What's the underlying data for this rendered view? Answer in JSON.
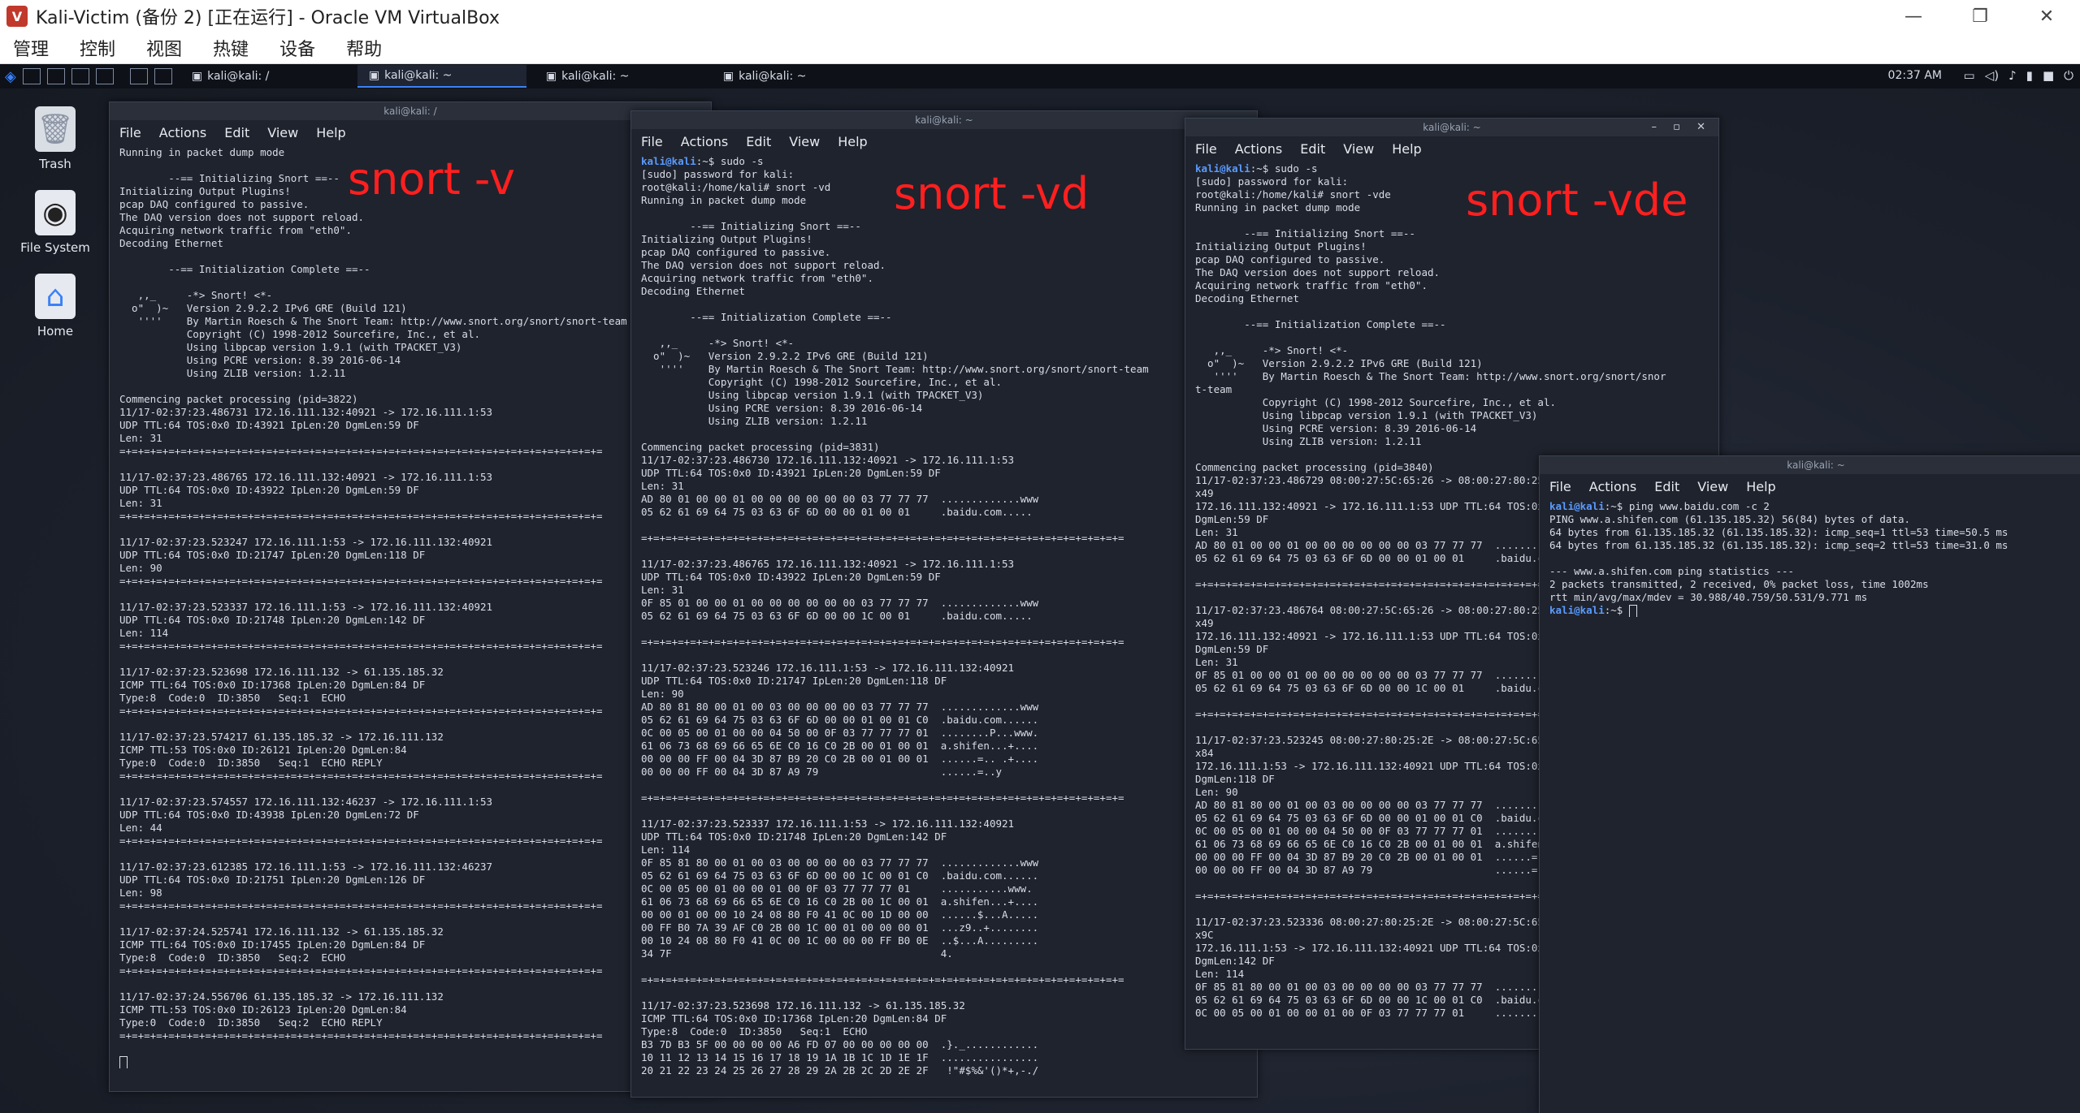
{
  "vbox": {
    "title": "Kali-Victim (备份 2) [正在运行] - Oracle VM VirtualBox",
    "menu": [
      "管理",
      "控制",
      "视图",
      "热键",
      "设备",
      "帮助"
    ],
    "min_label": "—",
    "max_label": "❐",
    "close_label": "✕"
  },
  "panel": {
    "tasks": [
      "kali@kali: /",
      "kali@kali: ~",
      "kali@kali: ~",
      "kali@kali: ~"
    ],
    "clock": "02:37 AM"
  },
  "desktop_icons": [
    {
      "label": "Trash",
      "icon": "trash-icon"
    },
    {
      "label": "File System",
      "icon": "drive-icon"
    },
    {
      "label": "Home",
      "icon": "home-icon"
    }
  ],
  "colors": {
    "annotation": "#ff1f1f",
    "prompt": "#5a9bff",
    "terminal_bg": "#1f232d"
  },
  "term_menu": [
    "File",
    "Actions",
    "Edit",
    "View",
    "Help"
  ],
  "terminals": [
    {
      "title": "kali@kali: /",
      "annotation": "snort -v",
      "lines": [
        "Running in packet dump mode",
        "",
        "        --== Initializing Snort ==--",
        "Initializing Output Plugins!",
        "pcap DAQ configured to passive.",
        "The DAQ version does not support reload.",
        "Acquiring network traffic from \"eth0\".",
        "Decoding Ethernet",
        "",
        "        --== Initialization Complete ==--",
        "",
        "   ,,_     -*> Snort! <*-",
        "  o\"  )~   Version 2.9.2.2 IPv6 GRE (Build 121)",
        "   ''''    By Martin Roesch & The Snort Team: http://www.snort.org/snort/snort-team",
        "           Copyright (C) 1998-2012 Sourcefire, Inc., et al.",
        "           Using libpcap version 1.9.1 (with TPACKET_V3)",
        "           Using PCRE version: 8.39 2016-06-14",
        "           Using ZLIB version: 1.2.11",
        "",
        "Commencing packet processing (pid=3822)",
        "11/17-02:37:23.486731 172.16.111.132:40921 -> 172.16.111.1:53",
        "UDP TTL:64 TOS:0x0 ID:43921 IpLen:20 DgmLen:59 DF",
        "Len: 31",
        "=+=+=+=+=+=+=+=+=+=+=+=+=+=+=+=+=+=+=+=+=+=+=+=+=+=+=+=+=+=+=+=+=+=+=+=+=+=+=+=",
        "",
        "11/17-02:37:23.486765 172.16.111.132:40921 -> 172.16.111.1:53",
        "UDP TTL:64 TOS:0x0 ID:43922 IpLen:20 DgmLen:59 DF",
        "Len: 31",
        "=+=+=+=+=+=+=+=+=+=+=+=+=+=+=+=+=+=+=+=+=+=+=+=+=+=+=+=+=+=+=+=+=+=+=+=+=+=+=+=",
        "",
        "11/17-02:37:23.523247 172.16.111.1:53 -> 172.16.111.132:40921",
        "UDP TTL:64 TOS:0x0 ID:21747 IpLen:20 DgmLen:118 DF",
        "Len: 90",
        "=+=+=+=+=+=+=+=+=+=+=+=+=+=+=+=+=+=+=+=+=+=+=+=+=+=+=+=+=+=+=+=+=+=+=+=+=+=+=+=",
        "",
        "11/17-02:37:23.523337 172.16.111.1:53 -> 172.16.111.132:40921",
        "UDP TTL:64 TOS:0x0 ID:21748 IpLen:20 DgmLen:142 DF",
        "Len: 114",
        "=+=+=+=+=+=+=+=+=+=+=+=+=+=+=+=+=+=+=+=+=+=+=+=+=+=+=+=+=+=+=+=+=+=+=+=+=+=+=+=",
        "",
        "11/17-02:37:23.523698 172.16.111.132 -> 61.135.185.32",
        "ICMP TTL:64 TOS:0x0 ID:17368 IpLen:20 DgmLen:84 DF",
        "Type:8  Code:0  ID:3850   Seq:1  ECHO",
        "=+=+=+=+=+=+=+=+=+=+=+=+=+=+=+=+=+=+=+=+=+=+=+=+=+=+=+=+=+=+=+=+=+=+=+=+=+=+=+=",
        "",
        "11/17-02:37:23.574217 61.135.185.32 -> 172.16.111.132",
        "ICMP TTL:53 TOS:0x0 ID:26121 IpLen:20 DgmLen:84",
        "Type:0  Code:0  ID:3850   Seq:1  ECHO REPLY",
        "=+=+=+=+=+=+=+=+=+=+=+=+=+=+=+=+=+=+=+=+=+=+=+=+=+=+=+=+=+=+=+=+=+=+=+=+=+=+=+=",
        "",
        "11/17-02:37:23.574557 172.16.111.132:46237 -> 172.16.111.1:53",
        "UDP TTL:64 TOS:0x0 ID:43938 IpLen:20 DgmLen:72 DF",
        "Len: 44",
        "=+=+=+=+=+=+=+=+=+=+=+=+=+=+=+=+=+=+=+=+=+=+=+=+=+=+=+=+=+=+=+=+=+=+=+=+=+=+=+=",
        "",
        "11/17-02:37:23.612385 172.16.111.1:53 -> 172.16.111.132:46237",
        "UDP TTL:64 TOS:0x0 ID:21751 IpLen:20 DgmLen:126 DF",
        "Len: 98",
        "=+=+=+=+=+=+=+=+=+=+=+=+=+=+=+=+=+=+=+=+=+=+=+=+=+=+=+=+=+=+=+=+=+=+=+=+=+=+=+=",
        "",
        "11/17-02:37:24.525741 172.16.111.132 -> 61.135.185.32",
        "ICMP TTL:64 TOS:0x0 ID:17455 IpLen:20 DgmLen:84 DF",
        "Type:8  Code:0  ID:3850   Seq:2  ECHO",
        "=+=+=+=+=+=+=+=+=+=+=+=+=+=+=+=+=+=+=+=+=+=+=+=+=+=+=+=+=+=+=+=+=+=+=+=+=+=+=+=",
        "",
        "11/17-02:37:24.556706 61.135.185.32 -> 172.16.111.132",
        "ICMP TTL:53 TOS:0x0 ID:26123 IpLen:20 DgmLen:84",
        "Type:0  Code:0  ID:3850   Seq:2  ECHO REPLY",
        "=+=+=+=+=+=+=+=+=+=+=+=+=+=+=+=+=+=+=+=+=+=+=+=+=+=+=+=+=+=+=+=+=+=+=+=+=+=+=+=",
        ""
      ]
    },
    {
      "title": "kali@kali: ~",
      "annotation": "snort -vd",
      "lines": [
        "kali@kali:~$ sudo -s",
        "[sudo] password for kali:",
        "root@kali:/home/kali# snort -vd",
        "Running in packet dump mode",
        "",
        "        --== Initializing Snort ==--",
        "Initializing Output Plugins!",
        "pcap DAQ configured to passive.",
        "The DAQ version does not support reload.",
        "Acquiring network traffic from \"eth0\".",
        "Decoding Ethernet",
        "",
        "        --== Initialization Complete ==--",
        "",
        "   ,,_     -*> Snort! <*-",
        "  o\"  )~   Version 2.9.2.2 IPv6 GRE (Build 121)",
        "   ''''    By Martin Roesch & The Snort Team: http://www.snort.org/snort/snort-team",
        "           Copyright (C) 1998-2012 Sourcefire, Inc., et al.",
        "           Using libpcap version 1.9.1 (with TPACKET_V3)",
        "           Using PCRE version: 8.39 2016-06-14",
        "           Using ZLIB version: 1.2.11",
        "",
        "Commencing packet processing (pid=3831)",
        "11/17-02:37:23.486730 172.16.111.132:40921 -> 172.16.111.1:53",
        "UDP TTL:64 TOS:0x0 ID:43921 IpLen:20 DgmLen:59 DF",
        "Len: 31",
        "AD 80 01 00 00 01 00 00 00 00 00 00 03 77 77 77  .............www",
        "05 62 61 69 64 75 03 63 6F 6D 00 00 01 00 01     .baidu.com.....",
        "",
        "=+=+=+=+=+=+=+=+=+=+=+=+=+=+=+=+=+=+=+=+=+=+=+=+=+=+=+=+=+=+=+=+=+=+=+=+=+=+=+=",
        "",
        "11/17-02:37:23.486765 172.16.111.132:40921 -> 172.16.111.1:53",
        "UDP TTL:64 TOS:0x0 ID:43922 IpLen:20 DgmLen:59 DF",
        "Len: 31",
        "0F 85 01 00 00 01 00 00 00 00 00 00 03 77 77 77  .............www",
        "05 62 61 69 64 75 03 63 6F 6D 00 00 1C 00 01     .baidu.com.....",
        "",
        "=+=+=+=+=+=+=+=+=+=+=+=+=+=+=+=+=+=+=+=+=+=+=+=+=+=+=+=+=+=+=+=+=+=+=+=+=+=+=+=",
        "",
        "11/17-02:37:23.523246 172.16.111.1:53 -> 172.16.111.132:40921",
        "UDP TTL:64 TOS:0x0 ID:21747 IpLen:20 DgmLen:118 DF",
        "Len: 90",
        "AD 80 81 80 00 01 00 03 00 00 00 00 03 77 77 77  .............www",
        "05 62 61 69 64 75 03 63 6F 6D 00 00 01 00 01 C0  .baidu.com......",
        "0C 00 05 00 01 00 00 04 50 00 0F 03 77 77 77 01  ........P...www.",
        "61 06 73 68 69 66 65 6E C0 16 C0 2B 00 01 00 01  a.shifen...+....",
        "00 00 00 FF 00 04 3D 87 B9 20 C0 2B 00 01 00 01  ......=.. .+....",
        "00 00 00 FF 00 04 3D 87 A9 79                    ......=..y",
        "",
        "=+=+=+=+=+=+=+=+=+=+=+=+=+=+=+=+=+=+=+=+=+=+=+=+=+=+=+=+=+=+=+=+=+=+=+=+=+=+=+=",
        "",
        "11/17-02:37:23.523337 172.16.111.1:53 -> 172.16.111.132:40921",
        "UDP TTL:64 TOS:0x0 ID:21748 IpLen:20 DgmLen:142 DF",
        "Len: 114",
        "0F 85 81 80 00 01 00 03 00 00 00 00 03 77 77 77  .............www",
        "05 62 61 69 64 75 03 63 6F 6D 00 00 1C 00 01 C0  .baidu.com......",
        "0C 00 05 00 01 00 00 01 00 0F 03 77 77 77 01     ...........www.",
        "61 06 73 68 69 66 65 6E C0 16 C0 2B 00 1C 00 01  a.shifen...+....",
        "00 00 01 00 00 10 24 08 80 F0 41 0C 00 1D 00 00  ......$...A.....",
        "00 FF B0 7A 39 AF C0 2B 00 1C 00 01 00 00 00 01  ...z9..+........",
        "00 10 24 08 80 F0 41 0C 00 1C 00 00 00 FF B0 0E  ..$...A.........",
        "34 7F                                            4.",
        "",
        "=+=+=+=+=+=+=+=+=+=+=+=+=+=+=+=+=+=+=+=+=+=+=+=+=+=+=+=+=+=+=+=+=+=+=+=+=+=+=+=",
        "",
        "11/17-02:37:23.523698 172.16.111.132 -> 61.135.185.32",
        "ICMP TTL:64 TOS:0x0 ID:17368 IpLen:20 DgmLen:84 DF",
        "Type:8  Code:0  ID:3850   Seq:1  ECHO",
        "B3 7D B3 5F 00 00 00 00 A6 FD 07 00 00 00 00 00  .}._............",
        "10 11 12 13 14 15 16 17 18 19 1A 1B 1C 1D 1E 1F  ................",
        "20 21 22 23 24 25 26 27 28 29 2A 2B 2C 2D 2E 2F   !\"#$%&'()*+,-./"
      ]
    },
    {
      "title": "kali@kali: ~",
      "annotation": "snort -vde",
      "lines": [
        "kali@kali:~$ sudo -s",
        "[sudo] password for kali:",
        "root@kali:/home/kali# snort -vde",
        "Running in packet dump mode",
        "",
        "        --== Initializing Snort ==--",
        "Initializing Output Plugins!",
        "pcap DAQ configured to passive.",
        "The DAQ version does not support reload.",
        "Acquiring network traffic from \"eth0\".",
        "Decoding Ethernet",
        "",
        "        --== Initialization Complete ==--",
        "",
        "   ,,_     -*> Snort! <*-",
        "  o\"  )~   Version 2.9.2.2 IPv6 GRE (Build 121)",
        "   ''''    By Martin Roesch & The Snort Team: http://www.snort.org/snort/snor",
        "t-team",
        "           Copyright (C) 1998-2012 Sourcefire, Inc., et al.",
        "           Using libpcap version 1.9.1 (with TPACKET_V3)",
        "           Using PCRE version: 8.39 2016-06-14",
        "           Using ZLIB version: 1.2.11",
        "",
        "Commencing packet processing (pid=3840)",
        "11/17-02:37:23.486729 08:00:27:5C:65:26 -> 08:00:27:80:25:2E type:0x800 len:0",
        "x49",
        "172.16.111.132:40921 -> 172.16.111.1:53 UDP TTL:64 TOS:0x0 ID:43921 IpLen:20",
        "DgmLen:59 DF",
        "Len: 31",
        "AD 80 01 00 00 01 00 00 00 00 00 00 03 77 77 77  .............www",
        "05 62 61 69 64 75 03 63 6F 6D 00 00 01 00 01     .baidu.com.....",
        "",
        "=+=+=+=+=+=+=+=+=+=+=+=+=+=+=+=+=+=+=+=+=+=+=+=+=+=+=+=+=+=+=+=+=+=+=+=+=+=+=+=",
        "",
        "11/17-02:37:23.486764 08:00:27:5C:65:26 -> 08:00:27:80:25:2E type:0x800 len:0",
        "x49",
        "172.16.111.132:40921 -> 172.16.111.1:53 UDP TTL:64 TOS:0x0 ID:43922 IpLen:20",
        "DgmLen:59 DF",
        "Len: 31",
        "0F 85 01 00 00 01 00 00 00 00 00 00 03 77 77 77  .............www",
        "05 62 61 69 64 75 03 63 6F 6D 00 00 1C 00 01     .baidu.com.....",
        "",
        "=+=+=+=+=+=+=+=+=+=+=+=+=+=+=+=+=+=+=+=+=+=+=+=+=+=+=+=+=+=+=+=+=+=+=+=+=+=+=+=",
        "",
        "11/17-02:37:23.523245 08:00:27:80:25:2E -> 08:00:27:5C:65:26 type:0x800 len:0",
        "x84",
        "172.16.111.1:53 -> 172.16.111.132:40921 UDP TTL:64 TOS:0x0 ID:21747 IpLen:20",
        "DgmLen:118 DF",
        "Len: 90",
        "AD 80 81 80 00 01 00 03 00 00 00 00 03 77 77 77  .............www",
        "05 62 61 69 64 75 03 63 6F 6D 00 00 01 00 01 C0  .baidu.com......",
        "0C 00 05 00 01 00 00 04 50 00 0F 03 77 77 77 01  ........P...www.",
        "61 06 73 68 69 66 65 6E C0 16 C0 2B 00 01 00 01  a.shifen...+....",
        "00 00 00 FF 00 04 3D 87 B9 20 C0 2B 00 01 00 01  ......=.. .+....",
        "00 00 00 FF 00 04 3D 87 A9 79                    ......=..y",
        "",
        "=+=+=+=+=+=+=+=+=+=+=+=+=+=+=+=+=+=+=+=+=+=+=+=+=+=+=+=+=+=+=+=+=+=+=+=+=+=+=+=",
        "",
        "11/17-02:37:23.523336 08:00:27:80:25:2E -> 08:00:27:5C:65:26 type:0x800 len:0",
        "x9C",
        "172.16.111.1:53 -> 172.16.111.132:40921 UDP TTL:64 TOS:0x0 ID:21748 IpLen:20",
        "DgmLen:142 DF",
        "Len: 114",
        "0F 85 81 80 00 01 00 03 00 00 00 00 03 77 77 77  .............www",
        "05 62 61 69 64 75 03 63 6F 6D 00 00 1C 00 01 C0  .baidu.com......",
        "0C 00 05 00 01 00 00 01 00 0F 03 77 77 77 01     ...........www."
      ]
    },
    {
      "title": "kali@kali: ~",
      "lines": [
        "kali@kali:~$ ping www.baidu.com -c 2",
        "PING www.a.shifen.com (61.135.185.32) 56(84) bytes of data.",
        "64 bytes from 61.135.185.32 (61.135.185.32): icmp_seq=1 ttl=53 time=50.5 ms",
        "64 bytes from 61.135.185.32 (61.135.185.32): icmp_seq=2 ttl=53 time=31.0 ms",
        "",
        "--- www.a.shifen.com ping statistics ---",
        "2 packets transmitted, 2 received, 0% packet loss, time 1002ms",
        "rtt min/avg/max/mdev = 30.988/40.759/50.531/9.771 ms",
        "kali@kali:~$ "
      ]
    }
  ]
}
